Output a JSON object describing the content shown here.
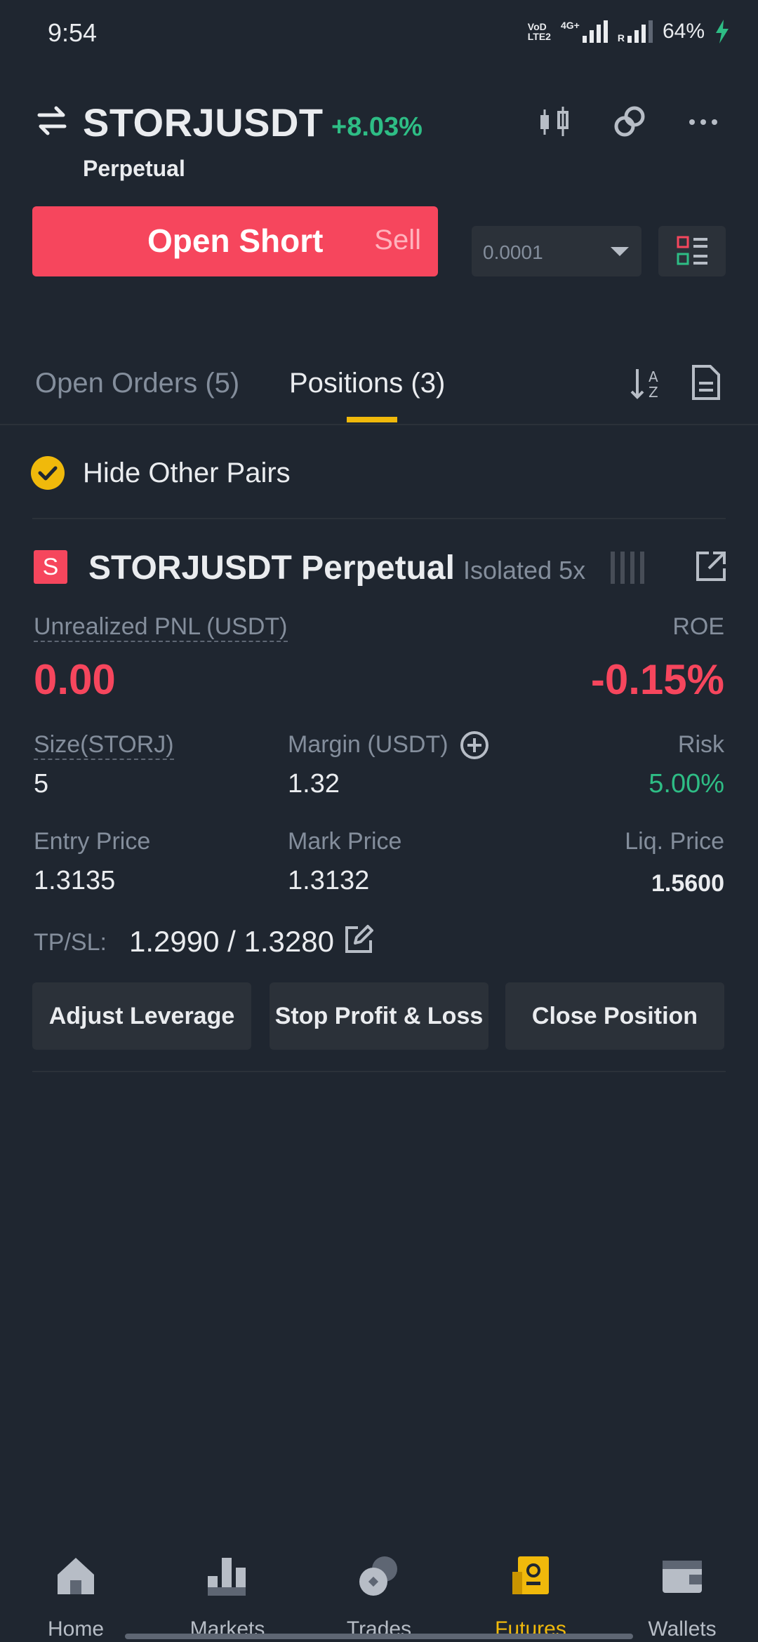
{
  "status_bar": {
    "time": "9:54",
    "carrier_line1": "VoD",
    "carrier_line2": "LTE2",
    "network": "4G+",
    "roaming": "R",
    "battery": "64%",
    "charging_icon": "bolt-icon"
  },
  "header": {
    "swap_icon": "swap-icon",
    "pair": "STORJUSDT",
    "change": "+8.03%",
    "contract_type": "Perpetual",
    "icons": [
      "candlestick-chart-icon",
      "link-icon",
      "more-icon"
    ]
  },
  "order": {
    "open_short_label": "Open Short",
    "sell_label": "Sell",
    "quantity_value": "0.0001",
    "layout_icon": "layout-list-icon"
  },
  "tabs": {
    "open_orders": "Open Orders (5)",
    "positions": "Positions (3)",
    "active": "positions"
  },
  "filter": {
    "hide_other_pairs": "Hide Other Pairs",
    "checked": true
  },
  "position": {
    "side_badge": "S",
    "title": "STORJUSDT Perpetual",
    "mode": "Isolated 5x",
    "unrealized_pnl_label": "Unrealized PNL (USDT)",
    "unrealized_pnl": "0.00",
    "roe_label": "ROE",
    "roe": "-0.15%",
    "size_label": "Size(STORJ)",
    "size": "5",
    "margin_label": "Margin (USDT)",
    "margin": "1.32",
    "risk_label": "Risk",
    "risk": "5.00%",
    "entry_price_label": "Entry Price",
    "entry_price": "1.3135",
    "mark_price_label": "Mark Price",
    "mark_price": "1.3132",
    "liq_price_label": "Liq. Price",
    "liq_price": "1.5600",
    "tpsl_label": "TP/SL:",
    "tpsl_value": "1.2990 / 1.3280"
  },
  "actions": {
    "adjust_leverage": "Adjust Leverage",
    "stop_profit_loss": "Stop Profit & Loss",
    "close_position": "Close Position"
  },
  "bottom_nav": [
    {
      "label": "Home",
      "icon": "home-icon"
    },
    {
      "label": "Markets",
      "icon": "markets-icon"
    },
    {
      "label": "Trades",
      "icon": "trades-icon"
    },
    {
      "label": "Futures",
      "icon": "futures-icon",
      "active": true
    },
    {
      "label": "Wallets",
      "icon": "wallet-icon"
    }
  ],
  "colors": {
    "background": "#1f2630",
    "surface": "#2b3139",
    "accent": "#f0b90b",
    "sell": "#f6465d",
    "buy": "#2ebd85",
    "muted": "#848e9c"
  }
}
